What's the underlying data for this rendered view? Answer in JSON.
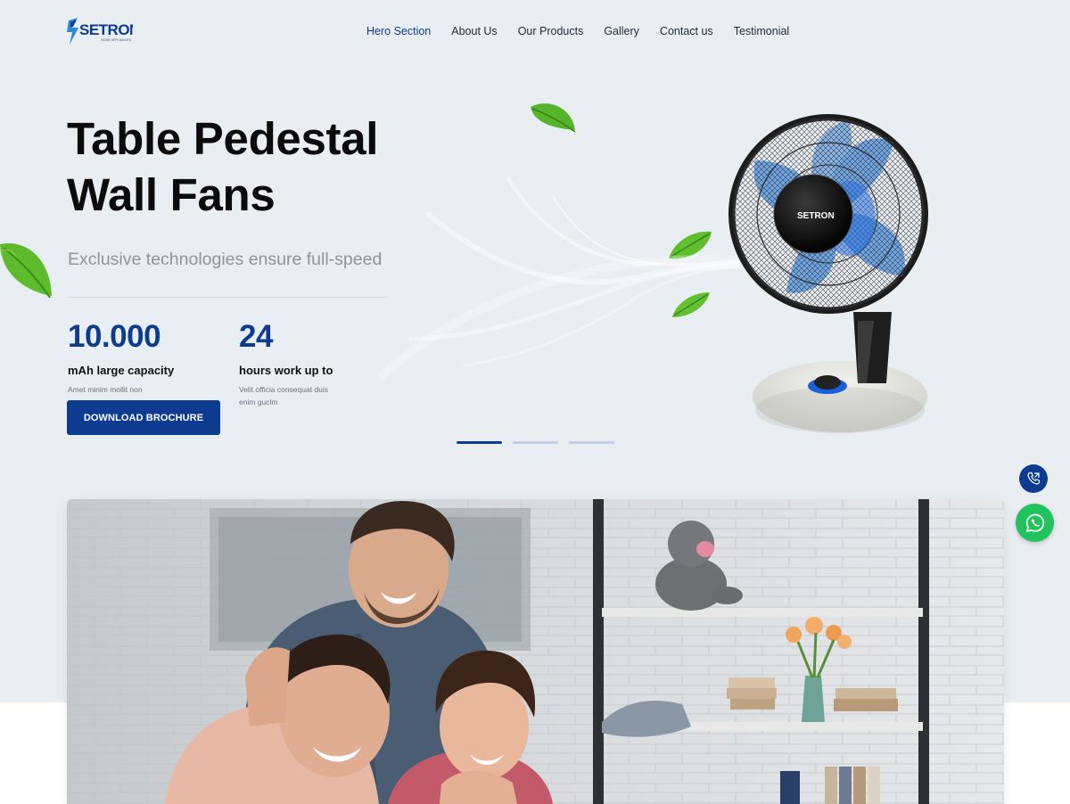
{
  "brand": {
    "name": "SETRON",
    "tagline": "HOME APPLIANCES",
    "colors": {
      "primary": "#0c3b8f",
      "accent": "#2a8ad8",
      "whatsapp": "#22c35e"
    }
  },
  "nav": {
    "items": [
      {
        "label": "Hero Section",
        "active": true
      },
      {
        "label": "About Us"
      },
      {
        "label": "Our Products"
      },
      {
        "label": "Gallery"
      },
      {
        "label": "Contact us"
      },
      {
        "label": "Testimonial"
      }
    ]
  },
  "hero": {
    "title_line1": "Table Pedestal",
    "title_line2": "Wall Fans",
    "subtitle": "Exclusive technologies ensure full-speed",
    "stats": [
      {
        "value": "10.000",
        "label": "mAh large capacity",
        "desc": "Amet minim mollit non"
      },
      {
        "value": "24",
        "label": "hours work up to",
        "desc": "Velit officia consequat duis enim guclm"
      }
    ],
    "cta_label": "DOWNLOAD BROCHURE",
    "fan_logo": "SETRON"
  },
  "slider": {
    "count": 3,
    "active_index": 0
  },
  "floating": {
    "phone_icon": "phone-icon",
    "whatsapp_icon": "whatsapp-icon"
  }
}
